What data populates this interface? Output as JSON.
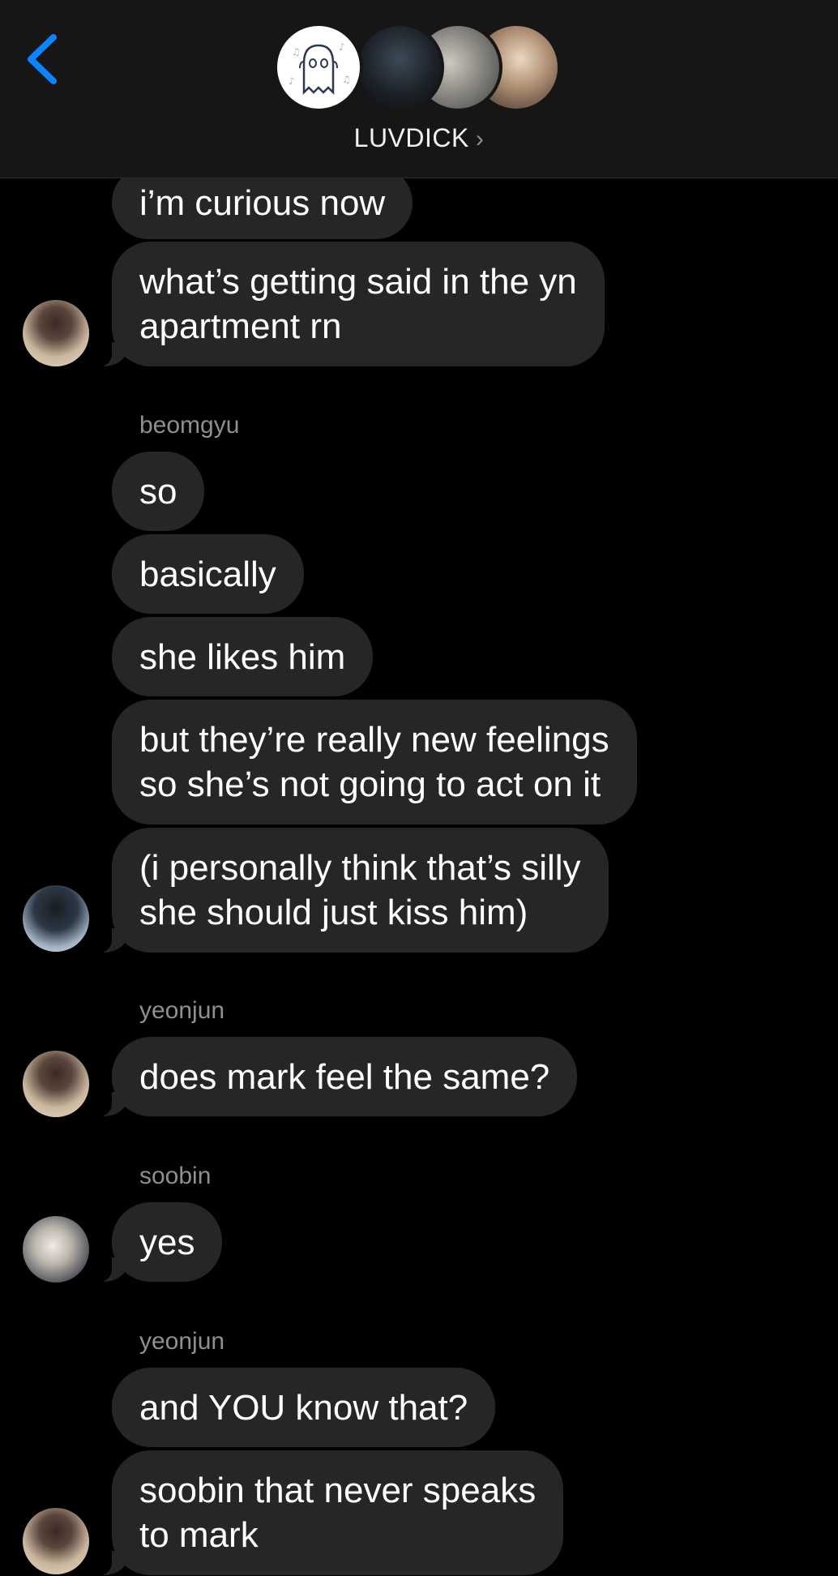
{
  "header": {
    "group_name": "LUVDICK",
    "chevron": "›",
    "back_icon": "chevron-left-icon",
    "accent_color": "#0a84ff"
  },
  "messages": [
    {
      "text_lines": [
        "i’m curious now"
      ]
    },
    {
      "text_lines": [
        "what’s getting said in the yn",
        "apartment rn"
      ]
    },
    {
      "sender": "beomgyu"
    },
    {
      "text_lines": [
        "so"
      ]
    },
    {
      "text_lines": [
        "basically"
      ]
    },
    {
      "text_lines": [
        "she likes him"
      ]
    },
    {
      "text_lines": [
        "but they’re really new feelings",
        "so she’s not going to act on it"
      ]
    },
    {
      "text_lines": [
        "(i personally think that’s silly",
        "she should just kiss him)"
      ]
    },
    {
      "sender": "yeonjun"
    },
    {
      "text_lines": [
        "does mark feel the same?"
      ]
    },
    {
      "sender": "soobin"
    },
    {
      "text_lines": [
        "yes"
      ]
    },
    {
      "sender": "yeonjun"
    },
    {
      "text_lines": [
        "and YOU know that?"
      ]
    },
    {
      "text_lines": [
        "soobin that never speaks",
        "to mark"
      ]
    }
  ],
  "colors": {
    "background": "#000000",
    "header_bg": "#161616",
    "bubble_bg": "#262628",
    "sender_text": "#8e8e93"
  }
}
